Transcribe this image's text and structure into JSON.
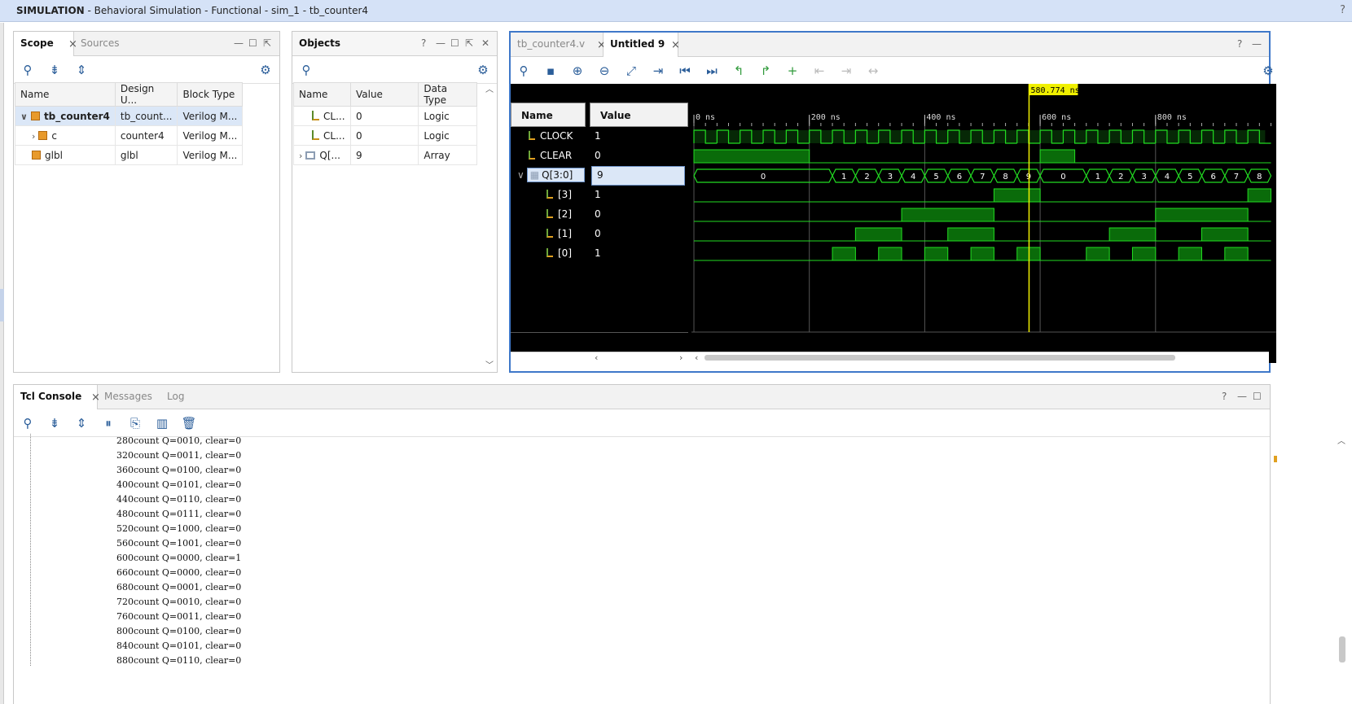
{
  "title": {
    "bold": "SIMULATION",
    "rest": " - Behavioral Simulation - Functional - sim_1 - tb_counter4",
    "help": "?"
  },
  "scope": {
    "tabs": [
      "Scope",
      "Sources"
    ],
    "columns": [
      "Name",
      "Design U...",
      "Block Type"
    ],
    "rows": [
      {
        "name": "tb_counter4",
        "design": "tb_count...",
        "type": "Verilog M..."
      },
      {
        "name": "c",
        "design": "counter4",
        "type": "Verilog M..."
      },
      {
        "name": "glbl",
        "design": "glbl",
        "type": "Verilog M..."
      }
    ]
  },
  "objects": {
    "title": "Objects",
    "columns": [
      "Name",
      "Value",
      "Data Type"
    ],
    "rows": [
      {
        "name": "CL...",
        "value": "0",
        "type": "Logic"
      },
      {
        "name": "CL...",
        "value": "0",
        "type": "Logic"
      },
      {
        "name": "Q[...",
        "value": "9",
        "type": "Array"
      }
    ]
  },
  "wave": {
    "tabs": [
      "tb_counter4.v",
      "Untitled 9"
    ],
    "cursor_label": "580.774 ns",
    "cursor_ns": 580.774,
    "headers": {
      "name": "Name",
      "value": "Value"
    },
    "time_labels": [
      "0 ns",
      "200 ns",
      "400 ns",
      "600 ns",
      "800 ns"
    ],
    "signals": [
      {
        "name": "CLOCK",
        "value": "1"
      },
      {
        "name": "CLEAR",
        "value": "0"
      },
      {
        "name": "Q[3:0]",
        "value": "9"
      },
      {
        "name": "[3]",
        "value": "1"
      },
      {
        "name": "[2]",
        "value": "0"
      },
      {
        "name": "[1]",
        "value": "0"
      },
      {
        "name": "[0]",
        "value": "1"
      }
    ],
    "bus_values": [
      "0",
      "1",
      "2",
      "3",
      "4",
      "5",
      "6",
      "7",
      "8",
      "9",
      "0",
      "1",
      "2",
      "3",
      "4",
      "5",
      "6",
      "7",
      "8"
    ]
  },
  "console": {
    "tabs": [
      "Tcl Console",
      "Messages",
      "Log"
    ],
    "lines": [
      "280count Q=0010,  clear=0",
      "320count Q=0011,  clear=0",
      "360count Q=0100,  clear=0",
      "400count Q=0101,  clear=0",
      "440count Q=0110,  clear=0",
      "480count Q=0111,  clear=0",
      "520count Q=1000,  clear=0",
      "560count Q=1001,  clear=0",
      "600count Q=0000,  clear=1",
      "660count Q=0000,  clear=0",
      "680count Q=0001,  clear=0",
      "720count Q=0010,  clear=0",
      "760count Q=0011,  clear=0",
      "800count Q=0100,  clear=0",
      "840count Q=0101,  clear=0",
      "880count Q=0110,  clear=0"
    ]
  },
  "colors": {
    "wave_green": "#22dd22",
    "cursor": "#f0f000",
    "accent": "#2a5d99"
  }
}
